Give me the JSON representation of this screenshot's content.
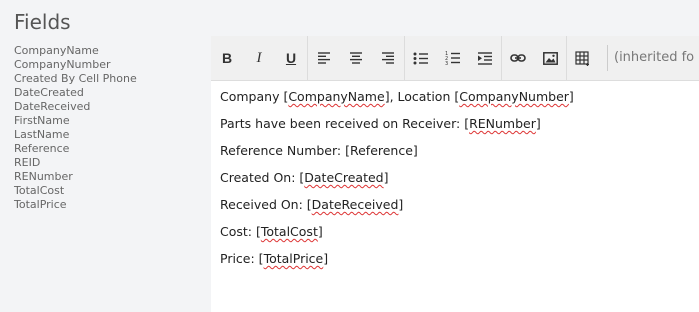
{
  "sidebar": {
    "title": "Fields",
    "items": [
      "CompanyName",
      "CompanyNumber",
      "Created By Cell Phone",
      "DateCreated",
      "DateReceived",
      "FirstName",
      "LastName",
      "Reference",
      "REID",
      "RENumber",
      "TotalCost",
      "TotalPrice"
    ]
  },
  "toolbar": {
    "bold": "B",
    "italic": "I",
    "underline": "U",
    "font_family": "(inherited fo"
  },
  "body": {
    "lines": [
      {
        "pre": "Company [",
        "tag": "CompanyName",
        "mid": "], Location [",
        "tag2": "CompanyNumber",
        "post": "]"
      },
      {
        "pre": "Parts have been received on Receiver: [",
        "tag": "RENumber",
        "post": "]"
      },
      {
        "pre": "Reference Number: [Reference]"
      },
      {
        "pre": "Created On: [",
        "tag": "DateCreated",
        "post": "]"
      },
      {
        "pre": "Received On: [",
        "tag": "DateReceived",
        "post": "]"
      },
      {
        "pre": "Cost: [",
        "tag": "TotalCost",
        "post": "]"
      },
      {
        "pre": "Price: [",
        "tag": "TotalPrice",
        "post": "]"
      }
    ]
  }
}
